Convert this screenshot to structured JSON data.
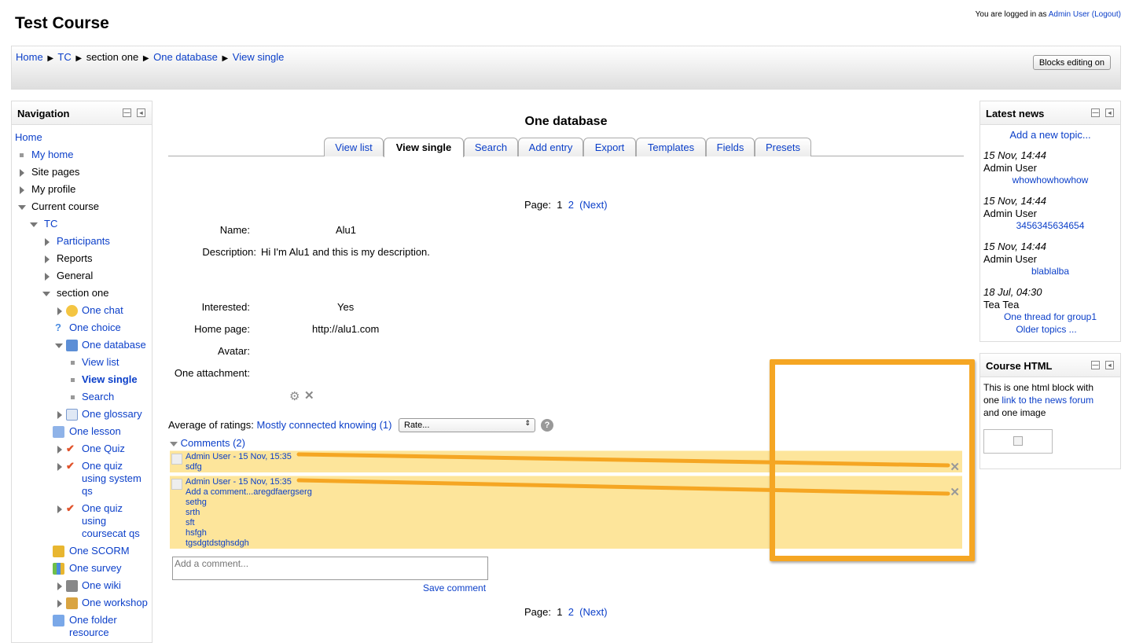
{
  "header": {
    "title": "Test Course",
    "login_prefix": "You are logged in as",
    "login_user": "Admin User",
    "logout": "(Logout)"
  },
  "breadcrumb": [
    "Home",
    "TC",
    "section one",
    "One database",
    "View single"
  ],
  "blocks_editing_label": "Blocks editing on",
  "navigation": {
    "title": "Navigation",
    "home": "Home",
    "my_home": "My home",
    "site_pages": "Site pages",
    "my_profile": "My profile",
    "current_course": "Current course",
    "tc": "TC",
    "participants": "Participants",
    "reports": "Reports",
    "general": "General",
    "section_one": "section one",
    "one_chat": "One chat",
    "one_choice": "One choice",
    "one_database": "One database",
    "view_list": "View list",
    "view_single": "View single",
    "search": "Search",
    "one_glossary": "One glossary",
    "one_lesson": "One lesson",
    "one_quiz": "One Quiz",
    "one_quiz_sys": [
      "One quiz",
      "using system",
      "qs"
    ],
    "one_quiz_cat": [
      "One quiz",
      "using",
      "coursecat qs"
    ],
    "one_scorm": "One SCORM",
    "one_survey": "One survey",
    "one_wiki": "One wiki",
    "one_workshop": "One workshop",
    "one_folder": [
      "One folder",
      "resource"
    ]
  },
  "main": {
    "title": "One database",
    "tabs": [
      "View list",
      "View single",
      "Search",
      "Add entry",
      "Export",
      "Templates",
      "Fields",
      "Presets"
    ],
    "paging": {
      "label": "Page:",
      "p1": "1",
      "p2": "2",
      "next": "(Next)"
    },
    "fields": [
      {
        "label": "Name:",
        "value": "Alu1"
      },
      {
        "label": "Description:",
        "value": "Hi I'm Alu1 and this is my description."
      },
      {
        "label": "Interested:",
        "value": "Yes"
      },
      {
        "label": "Home page:",
        "value": "http://alu1.com"
      },
      {
        "label": "Avatar:",
        "value": ""
      },
      {
        "label": "One attachment:",
        "value": ""
      }
    ],
    "ratings_label": "Average of ratings:",
    "ratings_value": "Mostly connected knowing (1)",
    "rate_select": "Rate...",
    "comments_toggle": "Comments (2)",
    "comments": [
      {
        "author": "Admin User - 15 Nov, 15:35",
        "lines": [
          "sdfg"
        ]
      },
      {
        "author": "Admin User - 15 Nov, 15:35",
        "lines": [
          "Add a comment...aregdfaergserg",
          "sethg",
          "srth",
          "sft",
          "hsfgh",
          "tgsdgtdstghsdgh"
        ]
      }
    ],
    "comment_placeholder": "Add a comment...",
    "save_comment": "Save comment"
  },
  "latest_news": {
    "title": "Latest news",
    "add_topic": "Add a new topic...",
    "items": [
      {
        "date": "15 Nov, 14:44",
        "author": "Admin User",
        "subject": "whowhowhowhow"
      },
      {
        "date": "15 Nov, 14:44",
        "author": "Admin User",
        "subject": "3456345634654"
      },
      {
        "date": "15 Nov, 14:44",
        "author": "Admin User",
        "subject": "blablalba"
      },
      {
        "date": "18 Jul, 04:30",
        "author": "Tea Tea",
        "subject": "One thread for group1"
      }
    ],
    "older": "Older topics ..."
  },
  "course_html": {
    "title": "Course HTML",
    "text1": "This is one html block with",
    "text2": "one",
    "link": "link to the news forum",
    "text3": "and one image"
  },
  "colors": {
    "link": "#0b3fc9",
    "comment_bg": "#fde59b",
    "annotation": "#f5a623"
  }
}
